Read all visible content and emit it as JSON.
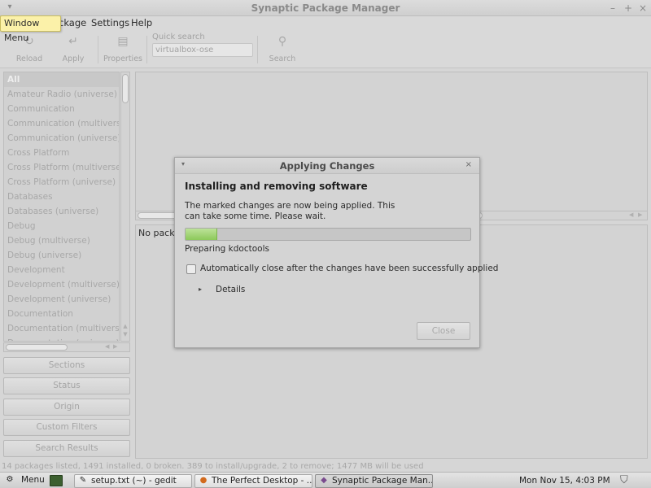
{
  "window": {
    "title": "Synaptic Package Manager",
    "menu_glyph": "▾",
    "minimize_glyph": "–",
    "maximize_glyph": "+",
    "close_glyph": "×"
  },
  "tooltip": "Window Menu",
  "menubar": {
    "package_visible": "ckage",
    "settings": "Settings",
    "help": "Help"
  },
  "toolbar": {
    "reload": {
      "label": "Reload",
      "icon": "↻"
    },
    "apply": {
      "label": "Apply",
      "icon": "↵"
    },
    "properties": {
      "label": "Properties",
      "icon": "▤"
    },
    "quick_search": {
      "label": "Quick search",
      "value": "virtualbox-ose"
    },
    "search": {
      "label": "Search",
      "icon": "⚲"
    }
  },
  "sections": [
    "All",
    "Amateur Radio (universe)",
    "Communication",
    "Communication (multiverse)",
    "Communication (universe)",
    "Cross Platform",
    "Cross Platform (multiverse)",
    "Cross Platform (universe)",
    "Databases",
    "Databases (universe)",
    "Debug",
    "Debug (multiverse)",
    "Debug (universe)",
    "Development",
    "Development (multiverse)",
    "Development (universe)",
    "Documentation",
    "Documentation (multiverse)",
    "Documentation (universe)"
  ],
  "filter_buttons": {
    "sections": "Sections",
    "status": "Status",
    "origin": "Origin",
    "custom_filters": "Custom Filters",
    "search_results": "Search Results"
  },
  "info_pane": {
    "text": "No packa"
  },
  "statusbar": "14 packages listed, 1491 installed, 0 broken. 389 to install/upgrade, 2 to remove; 1477 MB will be used",
  "dialog": {
    "title": "Applying Changes",
    "menu_glyph": "▾",
    "close_glyph": "×",
    "heading": "Installing and removing software",
    "message": "The marked changes are now being applied. This can take some time. Please wait.",
    "progress": 0.11,
    "progress_label": "Preparing kdoctools",
    "auto_close": {
      "label": "Automatically close after the changes have been successfully applied",
      "checked": false
    },
    "details": {
      "label": "Details",
      "expander": "▸"
    },
    "close_button": "Close"
  },
  "taskbar": {
    "menu": {
      "label": "Menu",
      "icon": "⚙"
    },
    "items": [
      {
        "label": "setup.txt (~) - gedit",
        "icon": "✎"
      },
      {
        "label": "The Perfect Desktop - ...",
        "icon": "●"
      },
      {
        "label": "Synaptic Package Man...",
        "icon": "◆"
      }
    ],
    "clock": "Mon Nov 15,  4:03 PM",
    "tray_icon": "⛉"
  },
  "colors": {
    "progress_fill": "#8cc95a",
    "tooltip_bg": "#fbf1a9"
  }
}
